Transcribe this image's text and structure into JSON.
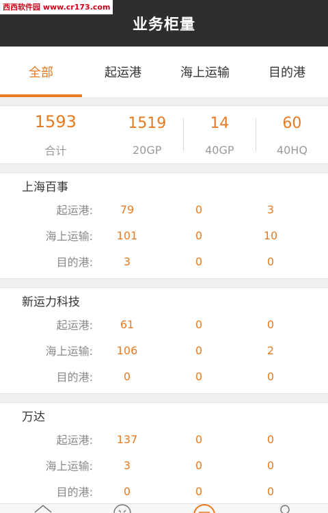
{
  "watermark": "西西软件园 www.cr173.com",
  "header": {
    "title": "业务柜量"
  },
  "tabs": [
    {
      "label": "全部",
      "active": true
    },
    {
      "label": "起运港",
      "active": false
    },
    {
      "label": "海上运输",
      "active": false
    },
    {
      "label": "目的港",
      "active": false
    }
  ],
  "summary": {
    "total": {
      "value": "1593",
      "label": "合计"
    },
    "gp20": {
      "value": "1519",
      "label": "20GP"
    },
    "gp40": {
      "value": "14",
      "label": "40GP"
    },
    "hq40": {
      "value": "60",
      "label": "40HQ"
    }
  },
  "companies": [
    {
      "name": "上海百事",
      "rows": [
        {
          "label": "起运港:",
          "gp20": "79",
          "gp40": "0",
          "hq40": "3"
        },
        {
          "label": "海上运输:",
          "gp20": "101",
          "gp40": "0",
          "hq40": "10"
        },
        {
          "label": "目的港:",
          "gp20": "3",
          "gp40": "0",
          "hq40": "0"
        }
      ]
    },
    {
      "name": "新运力科技",
      "rows": [
        {
          "label": "起运港:",
          "gp20": "61",
          "gp40": "0",
          "hq40": "0"
        },
        {
          "label": "海上运输:",
          "gp20": "106",
          "gp40": "0",
          "hq40": "2"
        },
        {
          "label": "目的港:",
          "gp20": "0",
          "gp40": "0",
          "hq40": "0"
        }
      ]
    },
    {
      "name": "万达",
      "rows": [
        {
          "label": "起运港:",
          "gp20": "137",
          "gp40": "0",
          "hq40": "0"
        },
        {
          "label": "海上运输:",
          "gp20": "3",
          "gp40": "0",
          "hq40": "0"
        },
        {
          "label": "目的港:",
          "gp20": "0",
          "gp40": "0",
          "hq40": "0"
        }
      ]
    }
  ],
  "bottom_nav": [
    {
      "icon": "home-icon"
    },
    {
      "icon": "smile-icon"
    },
    {
      "icon": "center-circle-icon"
    },
    {
      "icon": "user-icon"
    }
  ],
  "colors": {
    "accent": "#e97a1f",
    "header_bg": "#2e2e2e",
    "page_bg": "#efefef"
  }
}
